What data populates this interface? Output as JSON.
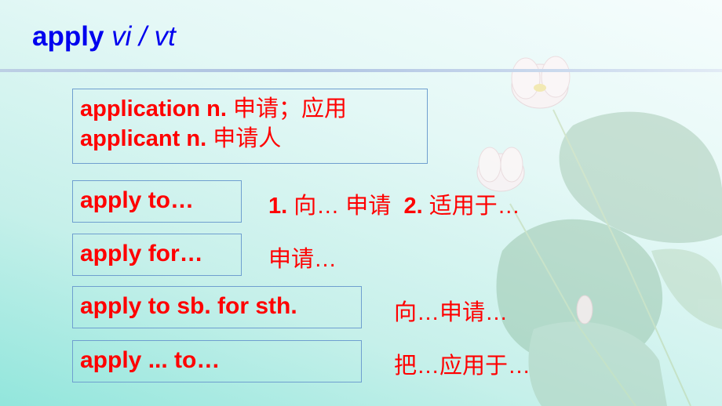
{
  "title": {
    "word": "apply",
    "part_of_speech": "vi / vt"
  },
  "derivatives": [
    {
      "word": "application n.",
      "meaning": "申请；应用"
    },
    {
      "word": "applicant n.",
      "meaning": "申请人"
    }
  ],
  "phrases": [
    {
      "phrase": "apply to…",
      "num1": "1.",
      "meaning1": "向… 申请",
      "num2": "2.",
      "meaning2": "适用于…"
    },
    {
      "phrase": "apply for…",
      "meaning": "申请…"
    },
    {
      "phrase": "apply to sb. for sth.",
      "meaning": "向…申请…"
    },
    {
      "phrase": "apply ... to…",
      "meaning": "把…应用于…"
    }
  ],
  "colors": {
    "title": "#0000ee",
    "text": "#ff0000",
    "box_border": "#6f9fcf",
    "rule": "#aec3e2"
  },
  "decoration": "lotus-flower-background"
}
